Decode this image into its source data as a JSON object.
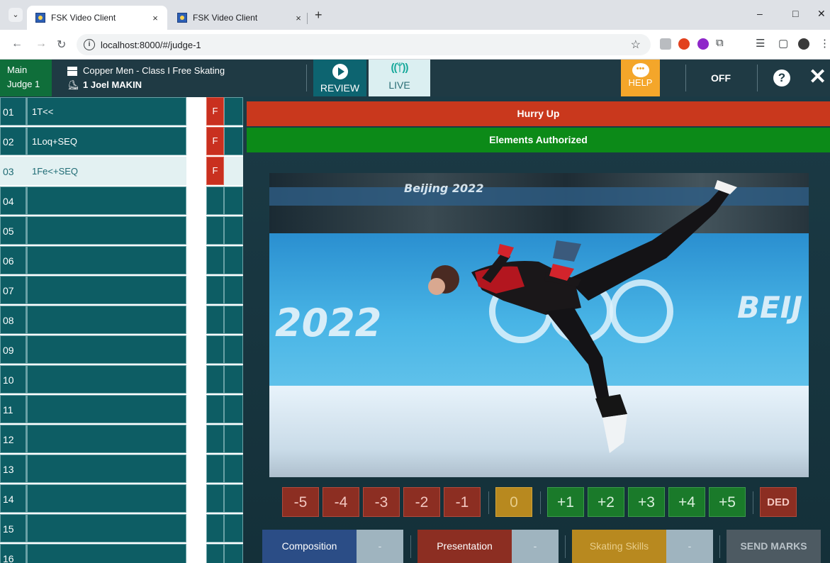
{
  "browser": {
    "tabs": [
      {
        "title": "FSK Video Client",
        "active": true
      },
      {
        "title": "FSK Video Client",
        "active": false
      }
    ],
    "url": "localhost:8000/#/judge-1",
    "tab_close": "×",
    "new_tab": "+",
    "window_controls": {
      "minimize": "–",
      "maximize": "□",
      "close": "✕"
    }
  },
  "header": {
    "judge_line1": "Main",
    "judge_line2": "Judge 1",
    "event": "Copper Men - Class I Free Skating",
    "skater": "1 Joel MAKIN",
    "review_label": "REVIEW",
    "live_label": "LIVE",
    "help_label": "HELP",
    "off_label": "OFF",
    "question_mark": "?",
    "close_mark": "✕"
  },
  "elements": [
    {
      "num": "01",
      "name": "1T<<",
      "flag": "F"
    },
    {
      "num": "02",
      "name": "1Loq+SEQ",
      "flag": "F"
    },
    {
      "num": "03",
      "name": "1Fe<+SEQ",
      "flag": "F",
      "selected": true
    },
    {
      "num": "04",
      "name": "",
      "flag": ""
    },
    {
      "num": "05",
      "name": "",
      "flag": ""
    },
    {
      "num": "06",
      "name": "",
      "flag": ""
    },
    {
      "num": "07",
      "name": "",
      "flag": ""
    },
    {
      "num": "08",
      "name": "",
      "flag": ""
    },
    {
      "num": "09",
      "name": "",
      "flag": ""
    },
    {
      "num": "10",
      "name": "",
      "flag": ""
    },
    {
      "num": "11",
      "name": "",
      "flag": ""
    },
    {
      "num": "12",
      "name": "",
      "flag": ""
    },
    {
      "num": "13",
      "name": "",
      "flag": ""
    },
    {
      "num": "14",
      "name": "",
      "flag": ""
    },
    {
      "num": "15",
      "name": "",
      "flag": ""
    },
    {
      "num": "16",
      "name": "",
      "flag": ""
    }
  ],
  "banners": {
    "hurry": "Hurry Up",
    "authorized": "Elements Authorized"
  },
  "video": {
    "year_text": "2022",
    "city_text": "BEIJ",
    "sponsor_text": "Beijing 2022"
  },
  "scores": [
    "-5",
    "-4",
    "-3",
    "-2",
    "-1",
    "0",
    "+1",
    "+2",
    "+3",
    "+4",
    "+5"
  ],
  "ded_label": "DED",
  "components": {
    "composition": "Composition",
    "composition_value": "-",
    "presentation": "Presentation",
    "presentation_value": "-",
    "skating_skills": "Skating Skills",
    "skating_skills_value": "-",
    "send": "SEND MARKS"
  },
  "colors": {
    "flag_red": "#c9301f",
    "element_teal": "#0d5d64",
    "hurry_red": "#c9381d",
    "authorized_green": "#0c8a18",
    "help_orange": "#f4a62a"
  }
}
